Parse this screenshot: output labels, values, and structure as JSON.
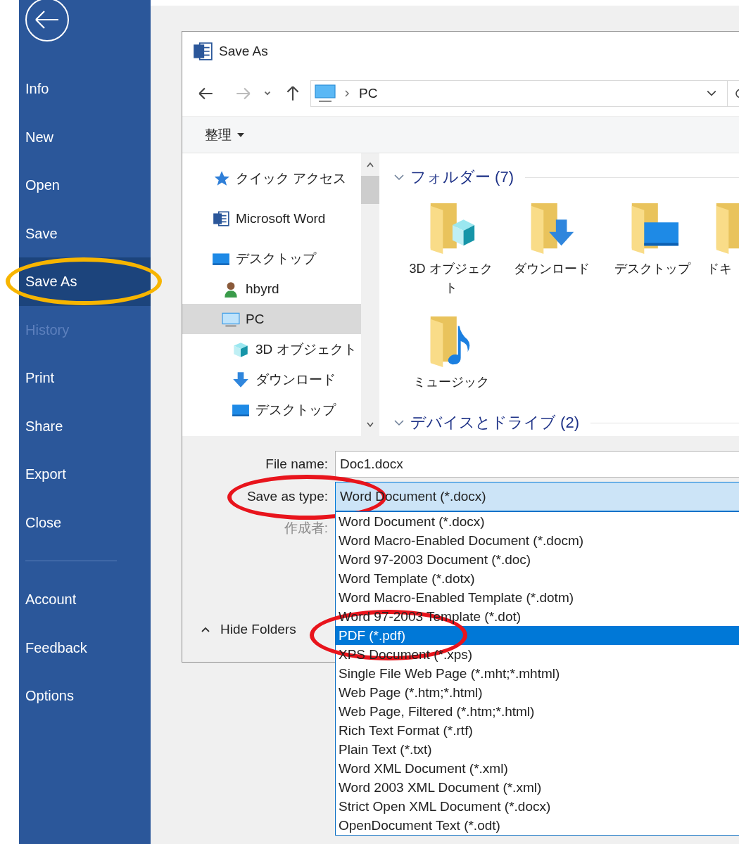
{
  "sidebar": {
    "items": [
      {
        "label": "Info",
        "selected": false,
        "disabled": false
      },
      {
        "label": "New",
        "selected": false,
        "disabled": false
      },
      {
        "label": "Open",
        "selected": false,
        "disabled": false
      },
      {
        "label": "Save",
        "selected": false,
        "disabled": false
      },
      {
        "label": "Save As",
        "selected": true,
        "disabled": false,
        "annotation": {
          "color": "#f7b500"
        }
      },
      {
        "label": "History",
        "selected": false,
        "disabled": true
      },
      {
        "label": "Print",
        "selected": false,
        "disabled": false
      },
      {
        "label": "Share",
        "selected": false,
        "disabled": false
      },
      {
        "label": "Export",
        "selected": false,
        "disabled": false
      },
      {
        "label": "Close",
        "selected": false,
        "disabled": false
      }
    ],
    "bottom_items": [
      {
        "label": "Account",
        "selected": false,
        "disabled": false
      },
      {
        "label": "Feedback",
        "selected": false,
        "disabled": false
      },
      {
        "label": "Options",
        "selected": false,
        "disabled": false
      }
    ]
  },
  "dialog": {
    "title": "Save As",
    "address": {
      "location": "PC"
    },
    "toolbar": {
      "organize": "整理"
    },
    "nav_pane": {
      "items": [
        {
          "label": "クイック アクセス",
          "kind": "star",
          "selected": false
        },
        {
          "label": "Microsoft Word",
          "kind": "word",
          "selected": false
        },
        {
          "label": "デスクトップ",
          "kind": "desktop",
          "selected": false,
          "children": [
            {
              "label": "hbyrd",
              "kind": "user",
              "selected": false
            },
            {
              "label": "PC",
              "kind": "pc",
              "selected": true,
              "children": [
                {
                  "label": "3D オブジェクト",
                  "kind": "objects",
                  "selected": false
                },
                {
                  "label": "ダウンロード",
                  "kind": "downloads",
                  "selected": false
                },
                {
                  "label": "デスクトップ",
                  "kind": "desktop",
                  "selected": false
                }
              ]
            }
          ]
        }
      ]
    },
    "groups": [
      {
        "title": "フォルダー (7)",
        "expanded": true,
        "items": [
          {
            "label": "3D オブジェクト",
            "kind": "objects",
            "cut_off": false
          },
          {
            "label": "ダウンロード",
            "kind": "downloads",
            "cut_off": false
          },
          {
            "label": "デスクトップ",
            "kind": "desktop",
            "cut_off": false
          },
          {
            "label": "ドキ",
            "kind": "plain",
            "cut_off": true
          },
          {
            "label": "ミュージック",
            "kind": "music",
            "cut_off": false
          }
        ]
      },
      {
        "title": "デバイスとドライブ (2)",
        "expanded": true
      }
    ],
    "form": {
      "file_name": {
        "label": "File name:",
        "value": "Doc1.docx"
      },
      "save_as_type": {
        "label": "Save as type:",
        "value": "Word Document (*.docx)",
        "expanded": true,
        "annotation": {
          "color": "#e8141c"
        }
      },
      "author": {
        "label": "作成者:",
        "disabled": true
      }
    },
    "hide_folders": "Hide Folders",
    "type_options": [
      {
        "label": "Word Document (*.docx)",
        "selected": false
      },
      {
        "label": "Word Macro-Enabled Document (*.docm)",
        "selected": false
      },
      {
        "label": "Word 97-2003 Document (*.doc)",
        "selected": false
      },
      {
        "label": "Word Template (*.dotx)",
        "selected": false
      },
      {
        "label": "Word Macro-Enabled Template (*.dotm)",
        "selected": false
      },
      {
        "label": "Word 97-2003 Template (*.dot)",
        "selected": false
      },
      {
        "label": "PDF (*.pdf)",
        "selected": true,
        "annotation": {
          "color": "#e8141c"
        }
      },
      {
        "label": "XPS Document (*.xps)",
        "selected": false
      },
      {
        "label": "Single File Web Page (*.mht;*.mhtml)",
        "selected": false
      },
      {
        "label": "Web Page (*.htm;*.html)",
        "selected": false
      },
      {
        "label": "Web Page, Filtered (*.htm;*.html)",
        "selected": false
      },
      {
        "label": "Rich Text Format (*.rtf)",
        "selected": false
      },
      {
        "label": "Plain Text (*.txt)",
        "selected": false
      },
      {
        "label": "Word XML Document (*.xml)",
        "selected": false
      },
      {
        "label": "Word 2003 XML Document (*.xml)",
        "selected": false
      },
      {
        "label": "Strict Open XML Document (*.docx)",
        "selected": false
      },
      {
        "label": "OpenDocument Text (*.odt)",
        "selected": false
      }
    ]
  }
}
